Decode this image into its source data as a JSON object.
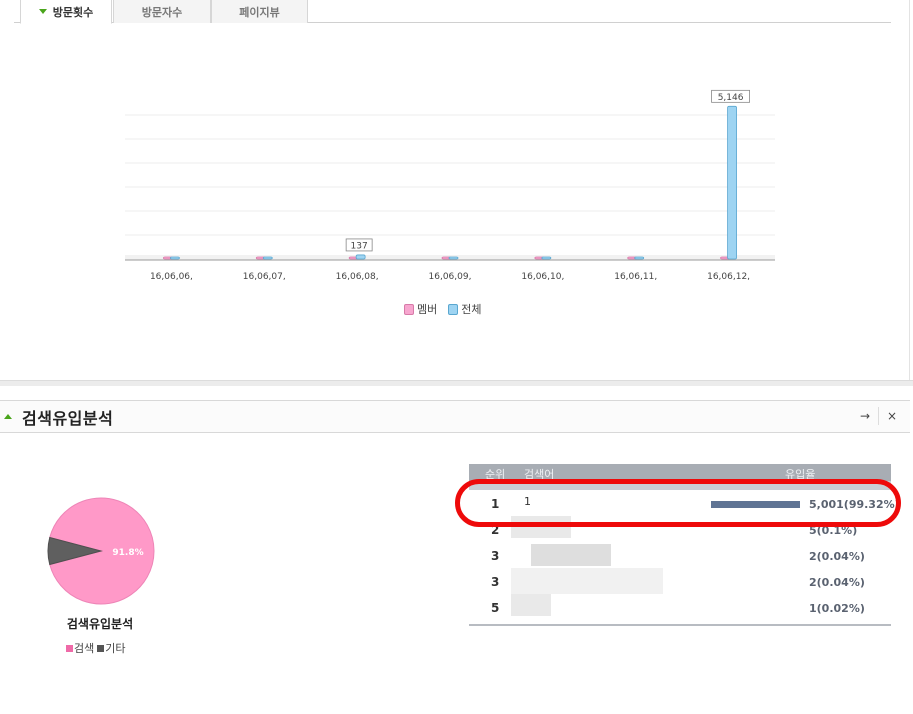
{
  "tabs": [
    {
      "label": "방문횟수",
      "active": true
    },
    {
      "label": "방문자수",
      "active": false
    },
    {
      "label": "페이지뷰",
      "active": false
    }
  ],
  "chart_data": {
    "type": "bar",
    "categories": [
      "16,06,06,",
      "16,06,07,",
      "16,06,08,",
      "16,06,09,",
      "16,06,10,",
      "16,06,11,",
      "16,06,12,"
    ],
    "series": [
      {
        "name": "멤버",
        "values": [
          0,
          0,
          2,
          0,
          0,
          0,
          0
        ],
        "color": "#f7a6cf"
      },
      {
        "name": "전체",
        "values": [
          22,
          26,
          137,
          26,
          26,
          26,
          5146
        ],
        "color": "#9ed4f2"
      }
    ],
    "data_labels": [
      {
        "category": "16,06,08,",
        "text": "137"
      },
      {
        "category": "16,06,12,",
        "text": "5,146"
      }
    ],
    "ylim": [
      0,
      6000
    ],
    "grid": true,
    "legend": "bottom"
  },
  "panel": {
    "title": "검색유입분석",
    "collapse_icon": "caret-up-icon",
    "buttons": {
      "move": "→",
      "close": "×"
    }
  },
  "pie": {
    "title": "검색유입분석",
    "slices": [
      {
        "name": "검색",
        "value": 91.8,
        "color": "#ff99c8"
      },
      {
        "name": "기타",
        "value": 8.2,
        "color": "#5f5f5f"
      }
    ],
    "label": "91.8%",
    "legend": [
      {
        "name": "검색",
        "color": "#ef6aa8"
      },
      {
        "name": "기타",
        "color": "#555555"
      }
    ]
  },
  "table": {
    "headers": {
      "rank": "순위",
      "keyword": "검색어",
      "share": "유입율"
    },
    "rows": [
      {
        "rank": "1",
        "keyword": "1",
        "value": "5,001(99.32%)",
        "bar_fraction": 0.9932
      },
      {
        "rank": "2",
        "keyword": "",
        "value": "5(0.1%)",
        "bar_fraction": 0.001
      },
      {
        "rank": "3",
        "keyword": "",
        "value": "2(0.04%)",
        "bar_fraction": 0.0004
      },
      {
        "rank": "3",
        "keyword": "",
        "value": "2(0.04%)",
        "bar_fraction": 0.0004
      },
      {
        "rank": "5",
        "keyword": "",
        "value": "1(0.02%)",
        "bar_fraction": 0.0002
      }
    ]
  }
}
